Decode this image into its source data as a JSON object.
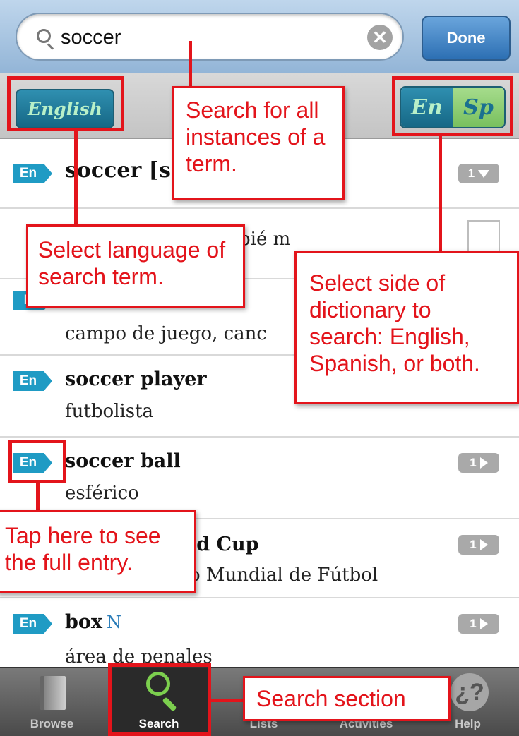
{
  "search": {
    "query": "soccer",
    "done_label": "Done"
  },
  "language": {
    "english_label": "English",
    "side_en": "En",
    "side_sp": "Sp"
  },
  "results": [
    {
      "badge": "En",
      "headword": "soccer [s",
      "count": "1",
      "expanded": true
    },
    {
      "translation": "pié m"
    },
    {
      "badge": "E"
    },
    {
      "translation": "campo de juego, canc"
    },
    {
      "badge": "En",
      "headword": "soccer player",
      "translation": "futbolista"
    },
    {
      "badge": "En",
      "headword": "soccer ball",
      "translation": "esférico",
      "count": "1"
    },
    {
      "headword": "ld Cup",
      "translation": "o Mundial de Fútbol",
      "count": "1"
    },
    {
      "badge": "En",
      "headword": "box",
      "pos": "N",
      "translation": "área de penales",
      "count": "1"
    }
  ],
  "tabs": [
    {
      "label": "Browse",
      "icon": "book-icon"
    },
    {
      "label": "Search",
      "icon": "search-icon",
      "active": true
    },
    {
      "label": "Lists",
      "icon": "list-icon"
    },
    {
      "label": "Activities",
      "icon": "music-note-icon"
    },
    {
      "label": "Help",
      "icon": "help-icon"
    }
  ],
  "callouts": {
    "search_all": "Search for all instances of a term.",
    "select_language": "Select language of search term.",
    "select_side": "Select side of dictionary to search: English, Spanish, or both.",
    "tap_here": "Tap here to see the full entry.",
    "search_section": "Search section"
  },
  "colors": {
    "annotation_red": "#e3141b",
    "en_badge_blue": "#1f9bc4",
    "search_tab_green": "#7ccf4e"
  }
}
